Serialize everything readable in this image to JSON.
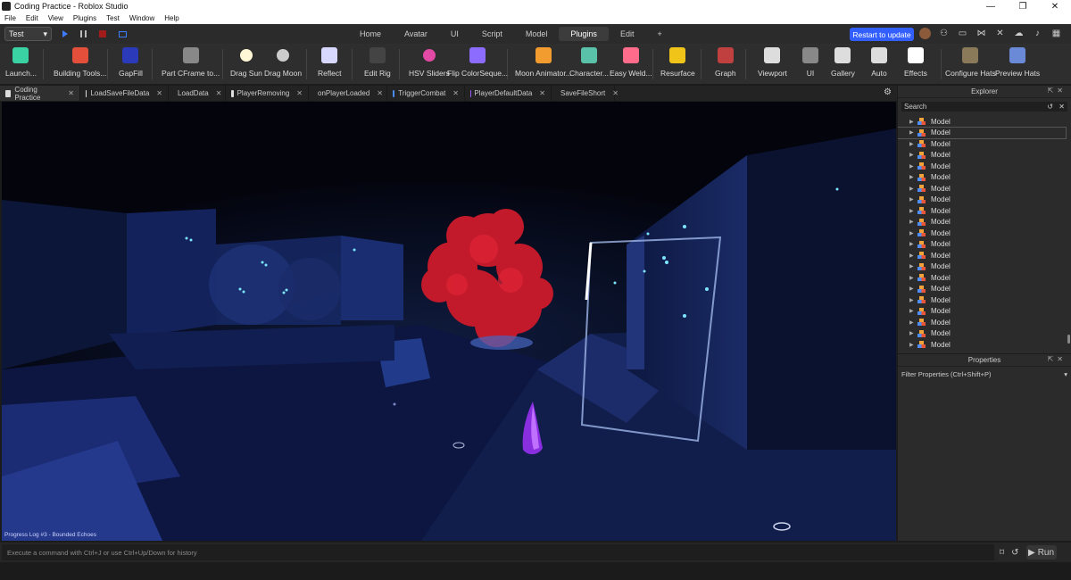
{
  "window": {
    "title": "Coding Practice - Roblox Studio",
    "controls": [
      "—",
      "❐",
      "✕"
    ]
  },
  "menu": [
    "File",
    "Edit",
    "View",
    "Plugins",
    "Test",
    "Window",
    "Help"
  ],
  "topbar": {
    "mode": "Test",
    "tabs": [
      "Home",
      "Avatar",
      "UI",
      "Script",
      "Model",
      "Plugins",
      "Edit",
      "+"
    ],
    "active_tab": "Plugins",
    "restart_label": "Restart to update"
  },
  "ribbon": [
    {
      "label": "Launch...",
      "icon": "launch-icon",
      "color": "#3ad1a3"
    },
    {
      "label": "Building Tools...",
      "icon": "building-tools-icon",
      "color": "#e34f3a"
    },
    {
      "label": "GapFill",
      "icon": "gapfill-icon",
      "color": "#2a3ab8"
    },
    {
      "label": "Part CFrame to...",
      "icon": "cframe-icon",
      "color": "#888888"
    },
    {
      "label": "Drag Sun",
      "icon": "sun-icon",
      "color": "#fff7d6"
    },
    {
      "label": "Drag Moon",
      "icon": "moon-icon",
      "color": "#cccccc"
    },
    {
      "label": "Reflect",
      "icon": "reflect-icon",
      "color": "#d8d8ff"
    },
    {
      "label": "Edit Rig",
      "icon": "rig-icon",
      "color": "#444444"
    },
    {
      "label": "HSV Sliders",
      "icon": "color-wheel-icon",
      "color": "#e24aa5"
    },
    {
      "label": "Flip ColorSeque...",
      "icon": "flip-icon",
      "color": "#8c6cff"
    },
    {
      "label": "Moon Animator...",
      "icon": "moon-animator-icon",
      "color": "#f29b2f"
    },
    {
      "label": "Character...",
      "icon": "character-icon",
      "color": "#59c2a8"
    },
    {
      "label": "Easy Weld...",
      "icon": "weld-icon",
      "color": "#ff6b8a"
    },
    {
      "label": "Resurface",
      "icon": "resurface-icon",
      "color": "#f0c419"
    },
    {
      "label": "Graph",
      "icon": "graph-icon",
      "color": "#c04040"
    },
    {
      "label": "Viewport",
      "icon": "camera-icon",
      "color": "#dddddd"
    },
    {
      "label": "UI",
      "icon": "ui-icon",
      "color": "#888888"
    },
    {
      "label": "Gallery",
      "icon": "gallery-icon",
      "color": "#dddddd"
    },
    {
      "label": "Auto",
      "icon": "auto-icon",
      "color": "#dddddd"
    },
    {
      "label": "Effects",
      "icon": "effects-icon",
      "color": "#ffffff"
    },
    {
      "label": "Configure Hats",
      "icon": "hat-icon",
      "color": "#8a7a5a"
    },
    {
      "label": "Preview Hats",
      "icon": "preview-hat-icon",
      "color": "#6a8ad8"
    }
  ],
  "doc_tabs": [
    {
      "label": "Coding Practice",
      "kind": "place",
      "active": true
    },
    {
      "label": "LoadSaveFileData",
      "kind": "script"
    },
    {
      "label": "LoadData",
      "kind": "script"
    },
    {
      "label": "PlayerRemoving",
      "kind": "script"
    },
    {
      "label": "onPlayerLoaded",
      "kind": "script"
    },
    {
      "label": "TriggerCombat",
      "kind": "event"
    },
    {
      "label": "PlayerDefaultData",
      "kind": "module"
    },
    {
      "label": "SaveFileShort",
      "kind": "module"
    }
  ],
  "viewport": {
    "caption": "Progress Log #3 - Bounded Echoes"
  },
  "explorer": {
    "title": "Explorer",
    "search_placeholder": "Search",
    "items": [
      "Model",
      "Model",
      "Model",
      "Model",
      "Model",
      "Model",
      "Model",
      "Model",
      "Model",
      "Model",
      "Model",
      "Model",
      "Model",
      "Model",
      "Model",
      "Model",
      "Model",
      "Model",
      "Model",
      "Model",
      "Model"
    ],
    "selected_index": 1
  },
  "properties": {
    "title": "Properties",
    "filter_placeholder": "Filter Properties (Ctrl+Shift+P)"
  },
  "command_bar": {
    "placeholder": "Execute a command with Ctrl+J or use Ctrl+Up/Down for history",
    "run_label": "Run"
  }
}
